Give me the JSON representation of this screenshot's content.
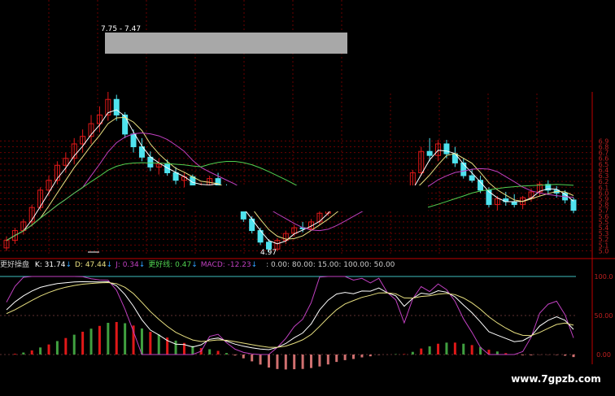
{
  "colors": {
    "up": "#e01818",
    "down": "#4fe3ef",
    "ma_fast": "#ffffff",
    "ma_mid": "#e8e080",
    "ma_purple": "#c040c0",
    "ma_green": "#50d050",
    "grid": "#6a0000",
    "axis": "#c00000",
    "k_line": "#ffffff",
    "d_line": "#e8e080",
    "j_line": "#c040c0",
    "cyan_ref": "#40c0c0"
  },
  "chart_data": [
    {
      "type": "candlestick",
      "annotations": [
        {
          "text": "7.75 - 7.47"
        },
        {
          "text": "4.97"
        }
      ],
      "y_ticks": [
        "6.9",
        "6.8",
        "6.7",
        "6.6",
        "6.5",
        "6.4",
        "6.3",
        "6.2",
        "6.1",
        "6.0",
        "5.9",
        "5.8",
        "5.7",
        "5.6",
        "5.5",
        "5.4",
        "5.3",
        "5.2",
        "5.1",
        "5.0"
      ],
      "ylim": [
        4.95,
        7.75
      ],
      "grid": true,
      "candles": [
        [
          5.05,
          5.25,
          5.0,
          5.18
        ],
        [
          5.18,
          5.4,
          5.12,
          5.35
        ],
        [
          5.35,
          5.55,
          5.28,
          5.5
        ],
        [
          5.5,
          5.8,
          5.42,
          5.75
        ],
        [
          5.75,
          6.1,
          5.7,
          6.05
        ],
        [
          6.05,
          6.3,
          5.95,
          6.22
        ],
        [
          6.22,
          6.55,
          6.15,
          6.48
        ],
        [
          6.48,
          6.7,
          6.35,
          6.6
        ],
        [
          6.6,
          6.95,
          6.5,
          6.85
        ],
        [
          6.85,
          7.1,
          6.7,
          6.98
        ],
        [
          6.98,
          7.35,
          6.85,
          7.2
        ],
        [
          7.2,
          7.5,
          7.05,
          7.35
        ],
        [
          7.35,
          7.75,
          7.25,
          7.62
        ],
        [
          7.62,
          7.7,
          7.25,
          7.35
        ],
        [
          7.35,
          7.4,
          6.95,
          7.02
        ],
        [
          7.02,
          7.1,
          6.7,
          6.8
        ],
        [
          6.8,
          6.95,
          6.55,
          6.62
        ],
        [
          6.62,
          6.72,
          6.38,
          6.45
        ],
        [
          6.45,
          6.6,
          6.32,
          6.5
        ],
        [
          6.5,
          6.58,
          6.3,
          6.35
        ],
        [
          6.35,
          6.45,
          6.15,
          6.22
        ],
        [
          6.22,
          6.35,
          6.1,
          6.28
        ],
        [
          6.28,
          6.32,
          6.0,
          6.05
        ],
        [
          6.05,
          6.18,
          5.9,
          6.12
        ],
        [
          6.12,
          6.3,
          6.05,
          6.25
        ],
        [
          6.25,
          6.35,
          6.05,
          6.1
        ],
        [
          6.1,
          6.15,
          5.85,
          5.92
        ],
        [
          5.92,
          6.0,
          5.7,
          5.75
        ],
        [
          5.75,
          5.82,
          5.5,
          5.55
        ],
        [
          5.55,
          5.6,
          5.3,
          5.35
        ],
        [
          5.35,
          5.4,
          5.1,
          5.15
        ],
        [
          5.15,
          5.2,
          4.97,
          5.03
        ],
        [
          5.03,
          5.22,
          5.0,
          5.18
        ],
        [
          5.18,
          5.35,
          5.12,
          5.3
        ],
        [
          5.3,
          5.45,
          5.25,
          5.4
        ],
        [
          5.4,
          5.5,
          5.32,
          5.38
        ],
        [
          5.38,
          5.55,
          5.35,
          5.5
        ],
        [
          5.5,
          5.7,
          5.45,
          5.65
        ],
        [
          5.65,
          5.85,
          5.6,
          5.8
        ],
        [
          5.8,
          6.05,
          5.75,
          5.98
        ],
        [
          5.98,
          6.1,
          5.85,
          5.92
        ],
        [
          5.92,
          6.0,
          5.78,
          5.85
        ],
        [
          5.85,
          6.05,
          5.8,
          6.0
        ],
        [
          6.0,
          6.08,
          5.88,
          5.95
        ],
        [
          5.95,
          6.1,
          5.9,
          6.05
        ],
        [
          6.05,
          6.12,
          5.85,
          5.9
        ],
        [
          5.9,
          6.0,
          5.82,
          5.95
        ],
        [
          5.95,
          6.05,
          5.85,
          5.88
        ],
        [
          5.88,
          6.4,
          5.85,
          6.35
        ],
        [
          6.35,
          6.8,
          6.3,
          6.72
        ],
        [
          6.72,
          6.95,
          6.55,
          6.65
        ],
        [
          6.65,
          6.92,
          6.55,
          6.85
        ],
        [
          6.85,
          6.92,
          6.6,
          6.68
        ],
        [
          6.68,
          6.8,
          6.45,
          6.52
        ],
        [
          6.52,
          6.6,
          6.25,
          6.3
        ],
        [
          6.3,
          6.42,
          6.18,
          6.22
        ],
        [
          6.22,
          6.3,
          6.0,
          6.05
        ],
        [
          6.05,
          6.1,
          5.75,
          5.8
        ],
        [
          5.8,
          5.95,
          5.7,
          5.9
        ],
        [
          5.9,
          6.02,
          5.78,
          5.85
        ],
        [
          5.85,
          5.98,
          5.75,
          5.8
        ],
        [
          5.8,
          5.95,
          5.72,
          5.92
        ],
        [
          5.92,
          6.08,
          5.85,
          6.02
        ],
        [
          6.02,
          6.2,
          5.95,
          6.15
        ],
        [
          6.15,
          6.22,
          5.98,
          6.05
        ],
        [
          6.05,
          6.12,
          5.92,
          6.0
        ],
        [
          6.0,
          6.05,
          5.82,
          5.88
        ],
        [
          5.88,
          5.92,
          5.65,
          5.7
        ]
      ]
    },
    {
      "type": "line",
      "title": "更好操盘",
      "indicators": [
        {
          "label": "K: 31.74",
          "arrow": "↓",
          "color": "#ffffff"
        },
        {
          "label": "D: 47.44",
          "arrow": "↓",
          "color": "#e8e080"
        },
        {
          "label": "J: 0.34",
          "arrow": "↓",
          "color": "#c040c0"
        },
        {
          "label": "更好线: 0.47",
          "arrow": "↓",
          "color": "#50d050"
        },
        {
          "label": "MACD: -12.23",
          "arrow": "↓",
          "color": "#c040c0"
        }
      ],
      "ref_labels": [
        ": 0.00",
        ": 80.00",
        ": 15.00",
        ": 100.00",
        ": 50.00"
      ],
      "y_ticks": [
        "100.0",
        "50.00",
        "0.00"
      ],
      "ylim": [
        0,
        100
      ]
    }
  ],
  "watermark": "www.7gpzb.com"
}
